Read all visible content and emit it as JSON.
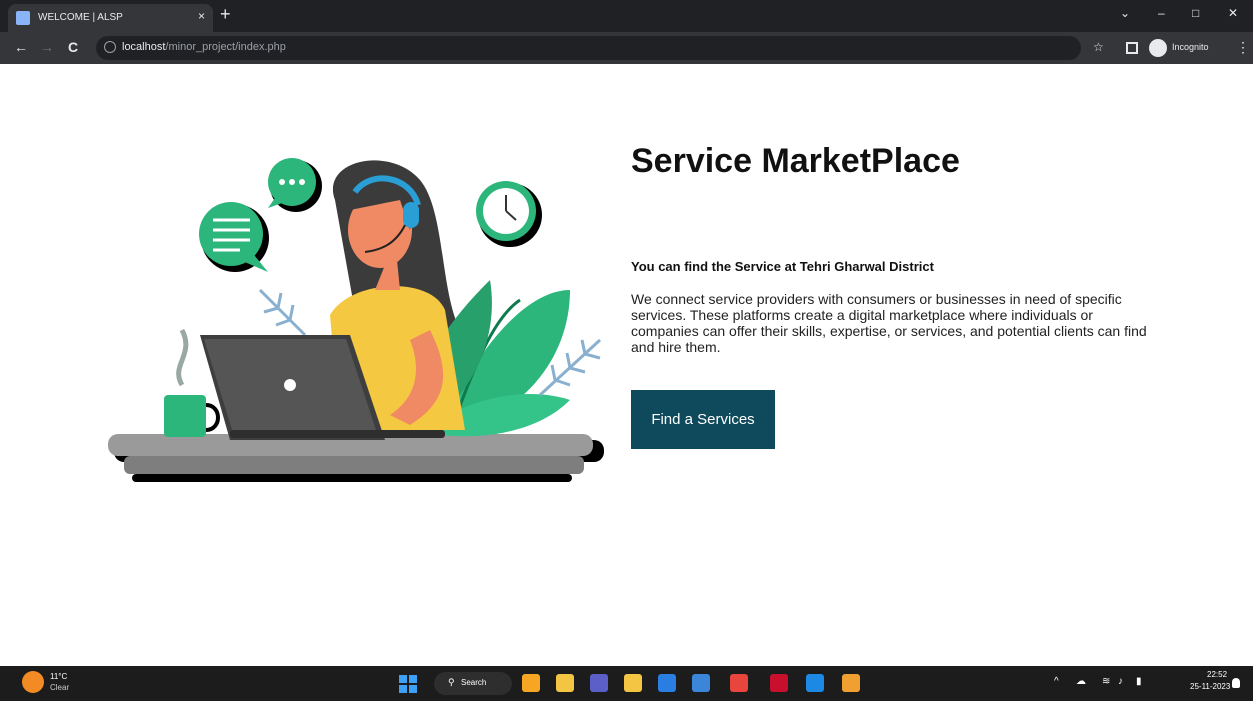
{
  "browser": {
    "tab_title": "WELCOME | ALSP",
    "tab_close": "×",
    "new_tab": "+",
    "url_host": "localhost",
    "url_path": "/minor_project/index.php",
    "profile_label": "Incognito",
    "window_controls": {
      "minimize": "–",
      "maximize": "□",
      "close": "✕"
    },
    "nav": {
      "back": "←",
      "forward": "→",
      "reload": "C"
    }
  },
  "hero": {
    "title": "Service MarketPlace",
    "subtitle": "You can find the Service at Tehri Gharwal District",
    "description": "We connect service providers with consumers or businesses in need of specific services. These platforms create a digital marketplace where individuals or companies can offer their skills, expertise, or services, and potential clients can find and hire them.",
    "cta_label": "Find a Services"
  },
  "colors": {
    "cta_bg": "#0e4a5c",
    "accent_green": "#2db67c",
    "accent_yellow": "#f5c842",
    "skin": "#f08a64"
  },
  "taskbar": {
    "weather_temp": "11°C",
    "weather_condition": "Clear",
    "search_label": "Search",
    "time": "22:52",
    "date": "25-11-2023",
    "apps": [
      {
        "name": "copilot-icon",
        "color": "#f6a623"
      },
      {
        "name": "file-explorer-icon",
        "color": "#f4c542"
      },
      {
        "name": "teams-icon",
        "color": "#5b5fc7"
      },
      {
        "name": "folder-icon",
        "color": "#f4c542"
      },
      {
        "name": "vscode-icon",
        "color": "#2a7de1"
      },
      {
        "name": "store-icon",
        "color": "#3b86d8"
      },
      {
        "name": "chrome-icon",
        "color": "#e8453c"
      },
      {
        "name": "mcafee-icon",
        "color": "#c8102e"
      },
      {
        "name": "edge-icon",
        "color": "#1e88e5"
      },
      {
        "name": "app-icon",
        "color": "#f0a030"
      }
    ]
  }
}
